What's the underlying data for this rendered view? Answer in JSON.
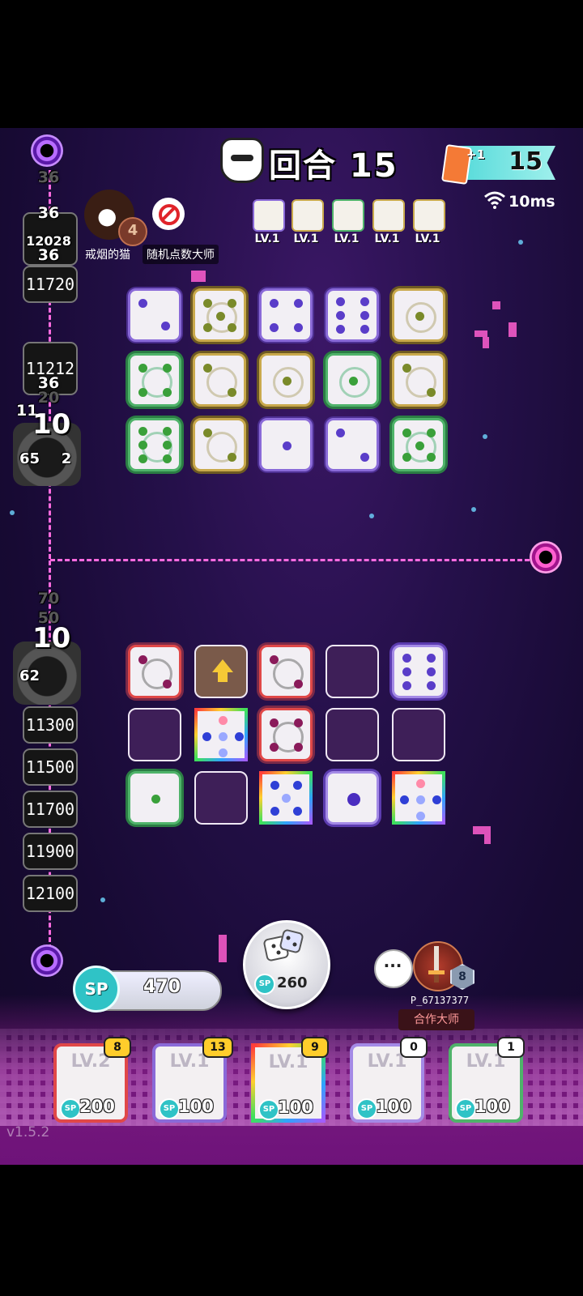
{
  "header": {
    "round_label": "回合 15",
    "cards_plus": "+1",
    "cards_count": "15",
    "ping": "10ms"
  },
  "opponent_top": {
    "name": "戒烟的猫",
    "rank": "4",
    "mode_tag": "随机点数大师"
  },
  "top_deck": [
    {
      "lv": "LV.1",
      "color": "#8a6ad8"
    },
    {
      "lv": "LV.1",
      "color": "#c9a94c"
    },
    {
      "lv": "LV.1",
      "color": "#4fb36a"
    },
    {
      "lv": "LV.1",
      "color": "#c9a94c"
    },
    {
      "lv": "LV.1",
      "color": "#c9a94c"
    }
  ],
  "top_lane": {
    "ghost_36": "36",
    "waves": [
      "36",
      "36"
    ],
    "hp1": "12028",
    "hp2": "11720",
    "hp3": "11212",
    "hp3_wave": "36",
    "ghost_20": "20",
    "hp4_partial": "11",
    "boss_label": "10",
    "boss_hp": "65",
    "boss_hp_tail": "2"
  },
  "bottom_lane": {
    "ghost_70": "70",
    "ghost_50": "50",
    "boss_label": "10",
    "boss_hp": "62",
    "hp_list": [
      "11300",
      "11500",
      "11700",
      "11900",
      "12100"
    ]
  },
  "player": {
    "sp_label": "SP",
    "sp": "470",
    "roll_cost": "260",
    "opponent_name": "P_67137377",
    "opponent_rank": "8",
    "coop_label": "合作大师",
    "chat_label": "···"
  },
  "deck": [
    {
      "lv": "LV.2",
      "cost": "200",
      "count": "8",
      "theme": "#e04848"
    },
    {
      "lv": "LV.1",
      "cost": "100",
      "count": "13",
      "theme": "#8a6ad8"
    },
    {
      "lv": "LV.1",
      "cost": "100",
      "count": "9",
      "theme": "rainbow"
    },
    {
      "lv": "LV.1",
      "cost": "100",
      "count": "0",
      "theme": "#a48ae6"
    },
    {
      "lv": "LV.1",
      "cost": "100",
      "count": "1",
      "theme": "#4fb36a"
    }
  ],
  "version": "v1.5.2"
}
